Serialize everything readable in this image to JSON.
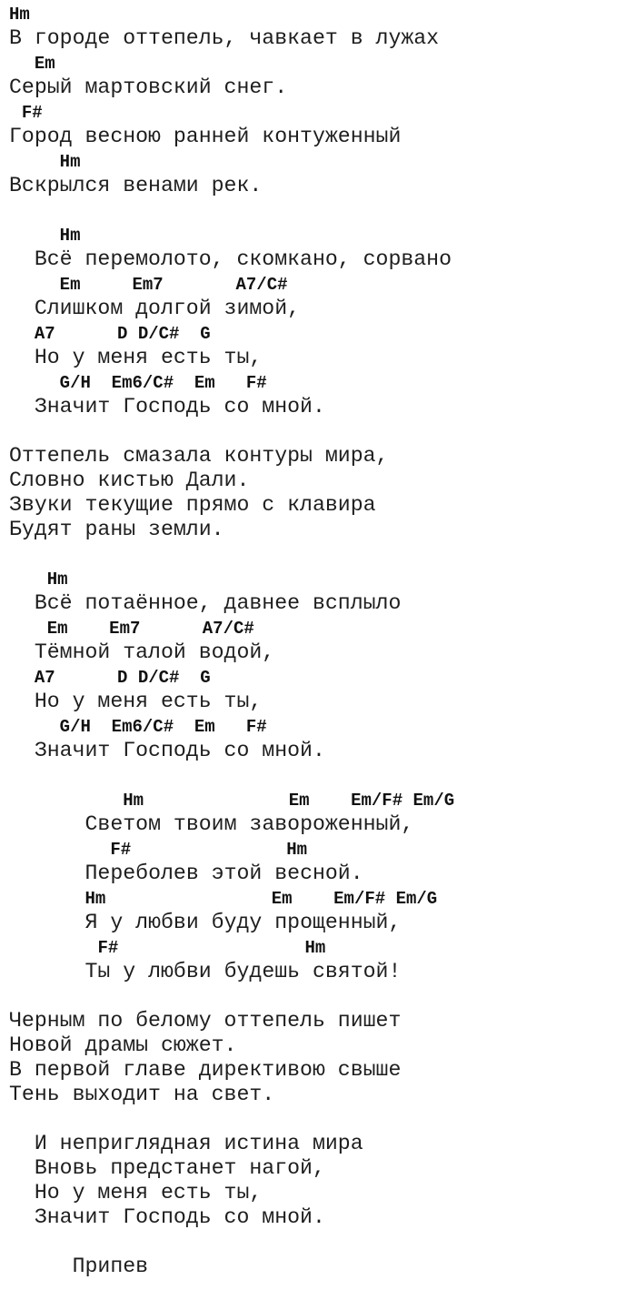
{
  "document": {
    "type": "song-chords-sheet",
    "lines": [
      {
        "kind": "chord",
        "indent": 0,
        "text": "Hm"
      },
      {
        "kind": "lyric",
        "indent": 0,
        "text": "В городе оттепель, чавкает в лужах"
      },
      {
        "kind": "chord",
        "indent": 2,
        "text": "Em"
      },
      {
        "kind": "lyric",
        "indent": 0,
        "text": "Серый мартовский снег."
      },
      {
        "kind": "chord",
        "indent": 1,
        "text": "F#"
      },
      {
        "kind": "lyric",
        "indent": 0,
        "text": "Город весною ранней контуженный"
      },
      {
        "kind": "chord",
        "indent": 4,
        "text": "Hm"
      },
      {
        "kind": "lyric",
        "indent": 0,
        "text": "Вскрылся венами рек."
      },
      {
        "kind": "blank"
      },
      {
        "kind": "chord",
        "indent": 4,
        "text": "Hm"
      },
      {
        "kind": "lyric",
        "indent": 2,
        "text": "Всё перемолото, скомкано, сорвано"
      },
      {
        "kind": "chord",
        "indent": 4,
        "text": "Em     Em7       A7/C#"
      },
      {
        "kind": "lyric",
        "indent": 2,
        "text": "Слишком долгой зимой,"
      },
      {
        "kind": "chord",
        "indent": 2,
        "text": "A7      D D/C#  G"
      },
      {
        "kind": "lyric",
        "indent": 2,
        "text": "Но у меня есть ты,"
      },
      {
        "kind": "chord",
        "indent": 4,
        "text": "G/H  Em6/C#  Em   F#"
      },
      {
        "kind": "lyric",
        "indent": 2,
        "text": "Значит Господь со мной."
      },
      {
        "kind": "blank"
      },
      {
        "kind": "lyric",
        "indent": 0,
        "text": "Оттепель смазала контуры мира,"
      },
      {
        "kind": "lyric",
        "indent": 0,
        "text": "Словно кистью Дали."
      },
      {
        "kind": "lyric",
        "indent": 0,
        "text": "Звуки текущие прямо с клавира"
      },
      {
        "kind": "lyric",
        "indent": 0,
        "text": "Будят раны земли."
      },
      {
        "kind": "blank"
      },
      {
        "kind": "chord",
        "indent": 3,
        "text": "Hm"
      },
      {
        "kind": "lyric",
        "indent": 2,
        "text": "Всё потаённое, давнее всплыло"
      },
      {
        "kind": "chord",
        "indent": 3,
        "text": "Em    Em7      A7/C#"
      },
      {
        "kind": "lyric",
        "indent": 2,
        "text": "Тёмной талой водой,"
      },
      {
        "kind": "chord",
        "indent": 2,
        "text": "A7      D D/C#  G"
      },
      {
        "kind": "lyric",
        "indent": 2,
        "text": "Но у меня есть ты,"
      },
      {
        "kind": "chord",
        "indent": 4,
        "text": "G/H  Em6/C#  Em   F#"
      },
      {
        "kind": "lyric",
        "indent": 2,
        "text": "Значит Господь со мной."
      },
      {
        "kind": "blank"
      },
      {
        "kind": "chord",
        "indent": 9,
        "text": "Hm              Em    Em/F# Em/G"
      },
      {
        "kind": "lyric",
        "indent": 6,
        "text": "Светом твоим завороженный,"
      },
      {
        "kind": "chord",
        "indent": 8,
        "text": "F#               Hm"
      },
      {
        "kind": "lyric",
        "indent": 6,
        "text": "Переболев этой весной."
      },
      {
        "kind": "chord",
        "indent": 6,
        "text": "Hm                Em    Em/F# Em/G"
      },
      {
        "kind": "lyric",
        "indent": 6,
        "text": "Я у любви буду прощенный,"
      },
      {
        "kind": "chord",
        "indent": 7,
        "text": "F#                  Hm"
      },
      {
        "kind": "lyric",
        "indent": 6,
        "text": "Ты у любви будешь святой!"
      },
      {
        "kind": "blank"
      },
      {
        "kind": "lyric",
        "indent": 0,
        "text": "Черным по белому оттепель пишет"
      },
      {
        "kind": "lyric",
        "indent": 0,
        "text": "Новой драмы сюжет."
      },
      {
        "kind": "lyric",
        "indent": 0,
        "text": "В первой главе директивою свыше"
      },
      {
        "kind": "lyric",
        "indent": 0,
        "text": "Тень выходит на свет."
      },
      {
        "kind": "blank"
      },
      {
        "kind": "lyric",
        "indent": 2,
        "text": "И неприглядная истина мира"
      },
      {
        "kind": "lyric",
        "indent": 2,
        "text": "Вновь предстанет нагой,"
      },
      {
        "kind": "lyric",
        "indent": 2,
        "text": "Но у меня есть ты,"
      },
      {
        "kind": "lyric",
        "indent": 2,
        "text": "Значит Господь со мной."
      },
      {
        "kind": "blank"
      },
      {
        "kind": "lyric",
        "indent": 5,
        "text": "Припев"
      }
    ]
  }
}
